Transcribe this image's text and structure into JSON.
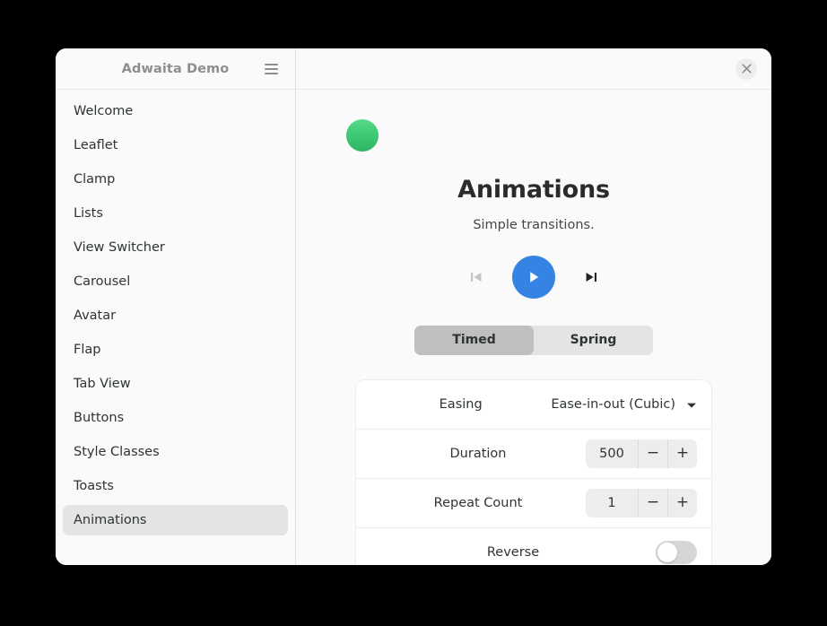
{
  "window": {
    "sidebar_title": "Adwaita Demo",
    "menu_icon": "hamburger-menu-icon",
    "close_icon": "close-icon"
  },
  "sidebar": {
    "items": [
      {
        "label": "Welcome",
        "selected": false
      },
      {
        "label": "Leaflet",
        "selected": false
      },
      {
        "label": "Clamp",
        "selected": false
      },
      {
        "label": "Lists",
        "selected": false
      },
      {
        "label": "View Switcher",
        "selected": false
      },
      {
        "label": "Carousel",
        "selected": false
      },
      {
        "label": "Avatar",
        "selected": false
      },
      {
        "label": "Flap",
        "selected": false
      },
      {
        "label": "Tab View",
        "selected": false
      },
      {
        "label": "Buttons",
        "selected": false
      },
      {
        "label": "Style Classes",
        "selected": false
      },
      {
        "label": "Toasts",
        "selected": false
      },
      {
        "label": "Animations",
        "selected": true
      }
    ]
  },
  "main": {
    "ball_color": "#3fcb75",
    "title": "Animations",
    "subtitle": "Simple transitions.",
    "controls": {
      "skip_backward_icon": "skip-backward-icon",
      "play_icon": "play-icon",
      "skip_forward_icon": "skip-forward-icon",
      "play_accent_color": "#3584e4"
    },
    "switcher": {
      "options": [
        {
          "label": "Timed",
          "active": true
        },
        {
          "label": "Spring",
          "active": false
        }
      ]
    },
    "settings": {
      "rows": [
        {
          "label": "Easing",
          "type": "dropdown",
          "value": "Ease-in-out (Cubic)",
          "icon": "chevron-down-icon"
        },
        {
          "label": "Duration",
          "type": "spin",
          "value": "500",
          "minus": "−",
          "plus": "+"
        },
        {
          "label": "Repeat Count",
          "type": "spin",
          "value": "1",
          "minus": "−",
          "plus": "+"
        },
        {
          "label": "Reverse",
          "type": "toggle",
          "value": "off"
        }
      ]
    }
  }
}
